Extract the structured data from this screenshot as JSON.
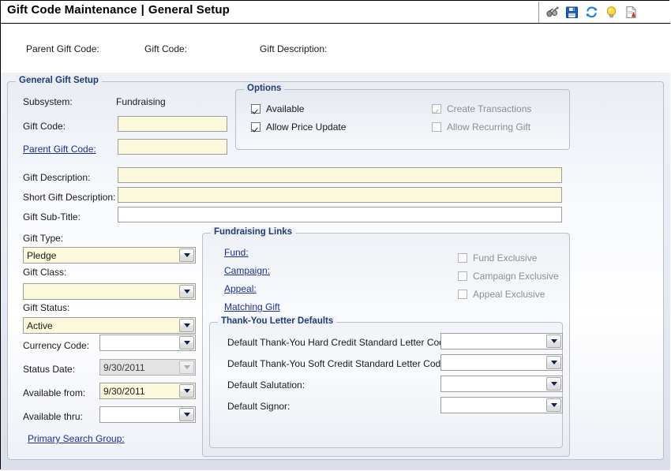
{
  "header": {
    "title_primary": "Gift Code Maintenance",
    "separator": "|",
    "title_secondary": "General Setup",
    "toolbar": [
      {
        "name": "binoculars-icon",
        "label": "Search"
      },
      {
        "name": "save-icon",
        "label": "Save"
      },
      {
        "name": "refresh-icon",
        "label": "Refresh"
      },
      {
        "name": "lightbulb-icon",
        "label": "Hints"
      },
      {
        "name": "report-icon",
        "label": "Report"
      }
    ]
  },
  "context_bar": {
    "parent_gift_code_label": "Parent Gift Code:",
    "gift_code_label": "Gift Code:",
    "gift_description_label": "Gift Description:",
    "parent_gift_code_value": "",
    "gift_code_value": "",
    "gift_description_value": ""
  },
  "general_gift_setup": {
    "legend": "General Gift Setup",
    "subsystem_label": "Subsystem:",
    "subsystem_value": "Fundraising",
    "gift_code_label": "Gift Code:",
    "gift_code_value": "",
    "parent_gift_code_label": "Parent Gift Code:",
    "parent_gift_code_value": "",
    "gift_description_label": "Gift Description:",
    "gift_description_value": "",
    "short_gift_description_label": "Short Gift Description:",
    "short_gift_description_value": "",
    "gift_sub_title_label": "Gift Sub-Title:",
    "gift_sub_title_value": "",
    "gift_type_label": "Gift Type:",
    "gift_type_value": "Pledge",
    "gift_class_label": "Gift Class:",
    "gift_class_value": "",
    "gift_status_label": "Gift Status:",
    "gift_status_value": "Active",
    "currency_code_label": "Currency Code:",
    "currency_code_value": "",
    "status_date_label": "Status Date:",
    "status_date_value": "9/30/2011",
    "available_from_label": "Available from:",
    "available_from_value": "9/30/2011",
    "available_thru_label": "Available thru:",
    "available_thru_value": "",
    "primary_search_group_label": "Primary Search Group:"
  },
  "options": {
    "legend": "Options",
    "items": [
      {
        "label": "Available",
        "checked": true,
        "disabled": false
      },
      {
        "label": "Allow Price Update",
        "checked": true,
        "disabled": false
      },
      {
        "label": "Create Transactions",
        "checked": true,
        "disabled": true
      },
      {
        "label": "Allow Recurring Gift",
        "checked": false,
        "disabled": true
      }
    ]
  },
  "fundraising_links": {
    "legend": "Fundraising Links",
    "links": [
      {
        "label": "Fund:"
      },
      {
        "label": "Campaign:"
      },
      {
        "label": "Appeal:"
      },
      {
        "label": "Matching Gift"
      }
    ],
    "exclusives": [
      {
        "label": "Fund Exclusive",
        "checked": false,
        "disabled": true
      },
      {
        "label": "Campaign Exclusive",
        "checked": false,
        "disabled": true
      },
      {
        "label": "Appeal Exclusive",
        "checked": false,
        "disabled": true
      }
    ]
  },
  "thank_you_letter_defaults": {
    "legend": "Thank-You Letter Defaults",
    "hard_credit_label": "Default Thank-You Hard Credit Standard Letter Code:",
    "hard_credit_value": "",
    "soft_credit_label": "Default Thank-You Soft Credit Standard Letter Code:",
    "soft_credit_value": "",
    "salutation_label": "Default Salutation:",
    "salutation_value": "",
    "signor_label": "Default Signor:",
    "signor_value": ""
  },
  "colors": {
    "required_field": "#fcf8dc",
    "link": "#1d2f8f",
    "legend": "#1f3d6e",
    "surface": "#e6eaf2",
    "disabled_text": "#8e8e8e"
  }
}
